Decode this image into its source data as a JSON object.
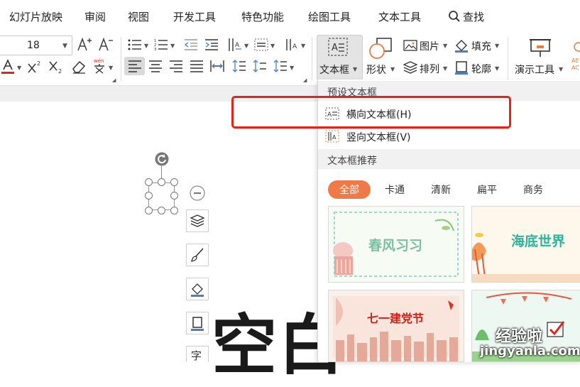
{
  "menubar": {
    "items": [
      "幻灯片放映",
      "审阅",
      "视图",
      "开发工具",
      "特色功能",
      "绘图工具",
      "文本工具"
    ],
    "search_label": "查找"
  },
  "toolbar": {
    "font_size": "18",
    "buttons": {
      "textbox": "文本框",
      "shape": "形状",
      "picture": "图片",
      "fill": "填充",
      "arrange": "排列",
      "outline": "轮廓",
      "presentation_tools": "演示工具"
    }
  },
  "dropdown": {
    "preset_header": "预设文本框",
    "horizontal_textbox": "横向文本框(H)",
    "vertical_textbox": "竖向文本框(V)",
    "recommend_header": "文本框推荐",
    "filters": [
      "全部",
      "卡通",
      "清新",
      "扁平",
      "商务"
    ],
    "thumbnails": [
      "春风习习",
      "海底世界",
      "七一建党节",
      ""
    ]
  },
  "slide": {
    "big_text": "空白"
  },
  "watermark": {
    "line1": "经验啦",
    "line2": "jingyanla.com"
  },
  "colors": {
    "accent": "#f07a47",
    "highlight": "#e0251b",
    "font_color": "#e0251b"
  }
}
